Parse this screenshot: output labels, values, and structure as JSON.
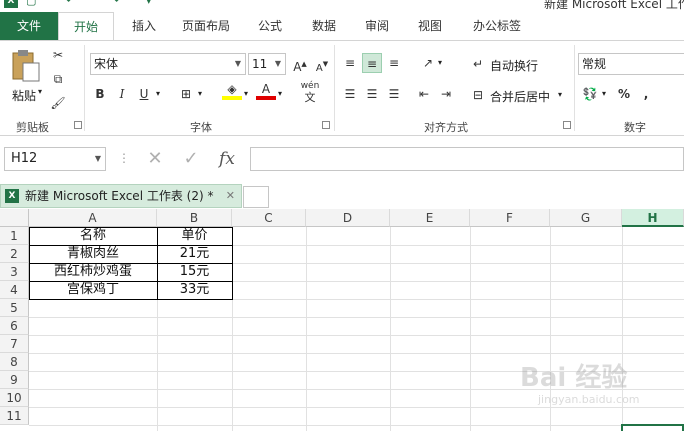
{
  "titlebar": {
    "app_icon": "X",
    "doc_title": "新建 Microsoft Excel 工作"
  },
  "tabs": [
    {
      "label": "文件"
    },
    {
      "label": "开始"
    },
    {
      "label": "插入"
    },
    {
      "label": "页面布局"
    },
    {
      "label": "公式"
    },
    {
      "label": "数据"
    },
    {
      "label": "审阅"
    },
    {
      "label": "视图"
    },
    {
      "label": "办公标签"
    }
  ],
  "ribbon": {
    "clipboard": {
      "paste_label": "粘贴",
      "group_label": "剪贴板"
    },
    "font": {
      "font_name": "宋体",
      "font_size": "11",
      "bold": "B",
      "italic": "I",
      "underline": "U",
      "wen": "wén",
      "group_label": "字体"
    },
    "alignment": {
      "wrap_label": "自动换行",
      "merge_label": "合并后居中",
      "group_label": "对齐方式"
    },
    "number": {
      "format": "常规",
      "percent": "%",
      "comma": ",",
      "group_label": "数字"
    }
  },
  "formula_bar": {
    "name_box": "H12",
    "fx": "fx",
    "cancel": "✕",
    "enter": "✓",
    "formula": ""
  },
  "workbook_tab": {
    "label": "新建 Microsoft Excel 工作表 (2) *",
    "close": "✕",
    "icon": "X"
  },
  "sheet": {
    "columns": [
      "A",
      "B",
      "C",
      "D",
      "E",
      "F",
      "G",
      "H"
    ],
    "selected_column": "H",
    "rows": [
      "1",
      "2",
      "3",
      "4",
      "5",
      "6",
      "7",
      "8",
      "9",
      "10",
      "11"
    ],
    "cells": [
      [
        "名称",
        "单价"
      ],
      [
        "青椒肉丝",
        "21元"
      ],
      [
        "西红柿炒鸡蛋",
        "15元"
      ],
      [
        "宫保鸡丁",
        "33元"
      ]
    ]
  },
  "watermark": {
    "text": "Bai 经验",
    "url": "jingyan.baidu.com"
  },
  "colors": {
    "accent": "#217346",
    "tab_active_bg": "#d6ebdd"
  }
}
